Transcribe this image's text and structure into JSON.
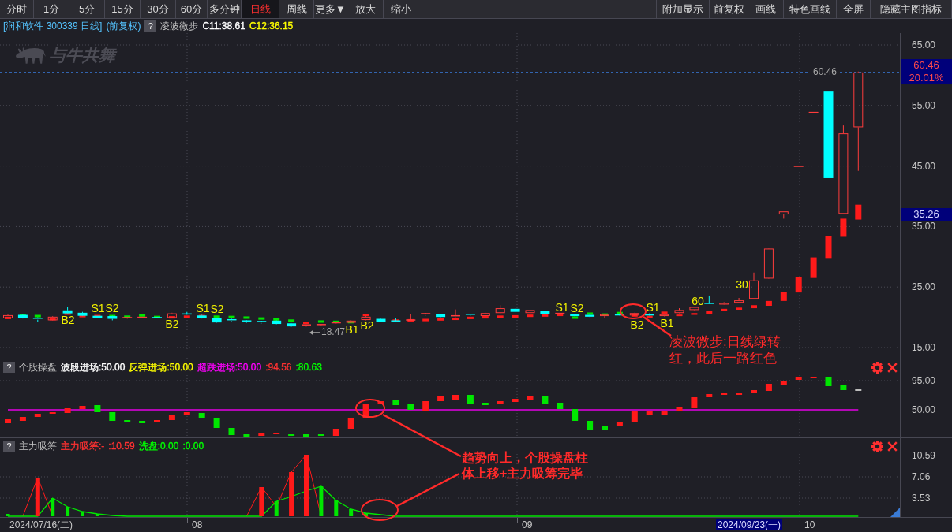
{
  "toolbar": {
    "periods": [
      {
        "label": "分时",
        "selected": false
      },
      {
        "label": "1分",
        "selected": false
      },
      {
        "label": "5分",
        "selected": false
      },
      {
        "label": "15分",
        "selected": false
      },
      {
        "label": "30分",
        "selected": false
      },
      {
        "label": "60分",
        "selected": false
      },
      {
        "label": "多分钟",
        "selected": false
      },
      {
        "label": "日线",
        "selected": true
      },
      {
        "label": "周线",
        "selected": false
      },
      {
        "label": "更多▼",
        "selected": false
      },
      {
        "label": "放大",
        "selected": false
      },
      {
        "label": "缩小",
        "selected": false
      }
    ],
    "actions": [
      {
        "label": "附加显示"
      },
      {
        "label": "前复权"
      },
      {
        "label": "画线"
      },
      {
        "label": "特色画线"
      },
      {
        "label": "全屏"
      },
      {
        "label": "隐藏主图指标"
      }
    ]
  },
  "main_chart": {
    "stock": "[润和软件 300339 日线]",
    "adjustment": "(前复权)",
    "help": "?",
    "indicator": "凌波微步",
    "values": [
      {
        "text": "C11:38.61",
        "color": "#ffffff"
      },
      {
        "text": "C12:36.15",
        "color": "#ffff00"
      }
    ],
    "logo": "与牛共舞",
    "y_axis": [
      "65.00",
      "55.00",
      "45.00",
      "35.00",
      "25.00",
      "15.00"
    ],
    "price_tags": [
      {
        "kind": "last",
        "text": "60.46"
      },
      {
        "kind": "change",
        "text": "20.01%"
      },
      {
        "kind": "cursor",
        "text": "35.26"
      }
    ],
    "high_label": "60.46",
    "low_label": "18.47",
    "signals": [
      "B2",
      "S1",
      "S2",
      "B2",
      "S1",
      "S2",
      "B1",
      "B2",
      "S1",
      "S2",
      "B2",
      "S1",
      "B1",
      "60",
      "30"
    ]
  },
  "indicator_panels": [
    {
      "help": "?",
      "name": "个股操盘",
      "values": [
        {
          "text": "波段进场:50.00",
          "color": "#ffffff"
        },
        {
          "text": "反弹进场:50.00",
          "color": "#ffff00"
        },
        {
          "text": "超跌进场:50.00",
          "color": "#ff00ff"
        },
        {
          "text": ":94.56",
          "color": "#ff3232"
        },
        {
          "text": ":80.63",
          "color": "#00ff00"
        }
      ],
      "y_axis": [
        "95.00",
        "50.00"
      ]
    },
    {
      "help": "?",
      "name": "主力吸筹",
      "values": [
        {
          "text": "主力吸筹:-",
          "color": "#ff3232"
        },
        {
          "text": ":10.59",
          "color": "#ff3232"
        },
        {
          "text": "洗盘:0.00",
          "color": "#00ff00"
        },
        {
          "text": ":0.00",
          "color": "#00ff00"
        }
      ],
      "y_axis": [
        "10.59",
        "7.06",
        "3.53"
      ]
    }
  ],
  "annotations": [
    "凌波微步:日线绿转红，此后一路红色",
    "趋势向上，个股操盘柱体上移+主力吸筹完毕"
  ],
  "date_axis": [
    {
      "kind": "tick",
      "text": "2024/07/16(二)"
    },
    {
      "kind": "tick",
      "text": "08"
    },
    {
      "kind": "tick",
      "text": "09"
    },
    {
      "kind": "cursor",
      "text": "2024/09/23(一)"
    },
    {
      "kind": "tick",
      "text": "10"
    }
  ]
}
